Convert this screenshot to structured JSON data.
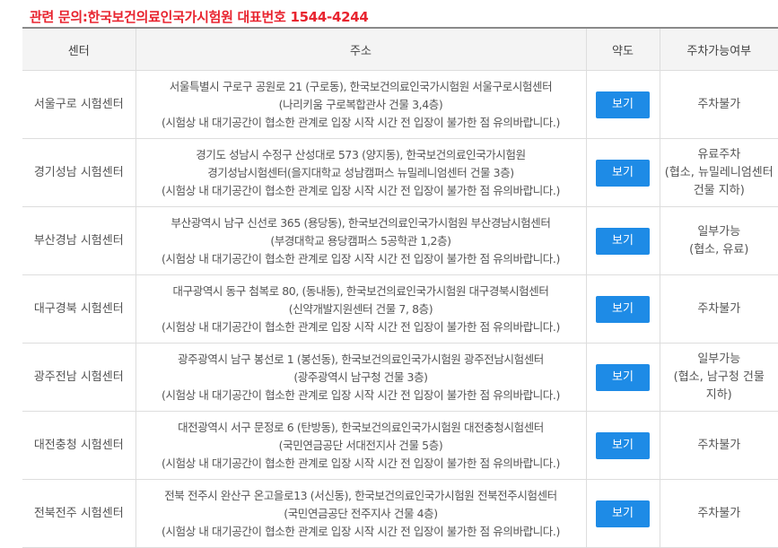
{
  "contact": "관련 문의:한국보건의료인국가시험원 대표번호 1544-4244",
  "headers": {
    "center": "센터",
    "address": "주소",
    "map": "약도",
    "parking": "주차가능여부"
  },
  "map_button_label": "보기",
  "rows": [
    {
      "center": "서울구로 시험센터",
      "address": [
        "서울특별시 구로구 공원로 21 (구로동), 한국보건의료인국가시험원 서울구로시험센터",
        "(나리키움 구로복합관사 건물 3,4층)",
        "(시험상 내 대기공간이 협소한 관계로 입장 시작 시간 전 입장이 불가한 점 유의바랍니다.)"
      ],
      "parking": [
        "주차불가"
      ]
    },
    {
      "center": "경기성남 시험센터",
      "address": [
        "경기도 성남시 수정구 산성대로 573 (양지동), 한국보건의료인국가시험원",
        "경기성남시험센터(을지대학교 성남캠퍼스 뉴밀레니엄센터 건물 3층)",
        "(시험상 내 대기공간이 협소한 관계로 입장 시작 시간 전 입장이 불가한 점 유의바랍니다.)"
      ],
      "parking": [
        "유료주차",
        "(협소, 뉴밀레니엄센터",
        "건물 지하)"
      ]
    },
    {
      "center": "부산경남 시험센터",
      "address": [
        "부산광역시 남구 신선로 365 (용당동), 한국보건의료인국가시험원 부산경남시험센터",
        "(부경대학교 용당캠퍼스 5공학관 1,2층)",
        "(시험상 내 대기공간이 협소한 관계로 입장 시작 시간 전 입장이 불가한 점 유의바랍니다.)"
      ],
      "parking": [
        "일부가능",
        "(협소, 유료)"
      ]
    },
    {
      "center": "대구경북 시험센터",
      "address": [
        "대구광역시 동구 첨복로 80, (동내동), 한국보건의료인국가시험원 대구경북시험센터",
        "(신약개발지원센터 건물 7, 8층)",
        "(시험상 내 대기공간이 협소한 관계로 입장 시작 시간 전 입장이 불가한 점 유의바랍니다.)"
      ],
      "parking": [
        "주차불가"
      ]
    },
    {
      "center": "광주전남 시험센터",
      "address": [
        "광주광역시 남구 봉선로 1 (봉선동), 한국보건의료인국가시험원 광주전남시험센터",
        "(광주광역시 남구청 건물 3층)",
        "(시험상 내 대기공간이 협소한 관계로 입장 시작 시간 전 입장이 불가한 점 유의바랍니다.)"
      ],
      "parking": [
        "일부가능",
        "(협소, 남구청 건물",
        "지하)"
      ]
    },
    {
      "center": "대전충청 시험센터",
      "address": [
        "대전광역시 서구 문정로 6 (탄방동), 한국보건의료인국가시험원 대전충청시험센터",
        "(국민연금공단 서대전지사 건물 5층)",
        "(시험상 내 대기공간이 협소한 관계로 입장 시작 시간 전 입장이 불가한 점 유의바랍니다.)"
      ],
      "parking": [
        "주차불가"
      ]
    },
    {
      "center": "전북전주 시험센터",
      "address": [
        "전북 전주시 완산구 온고을로13 (서신동), 한국보건의료인국가시험원 전북전주시험센터",
        "(국민연금공단 전주지사 건물 4층)",
        "(시험상 내 대기공간이 협소한 관계로 입장 시작 시간 전 입장이 불가한 점 유의바랍니다.)"
      ],
      "parking": [
        "주차불가"
      ]
    }
  ]
}
